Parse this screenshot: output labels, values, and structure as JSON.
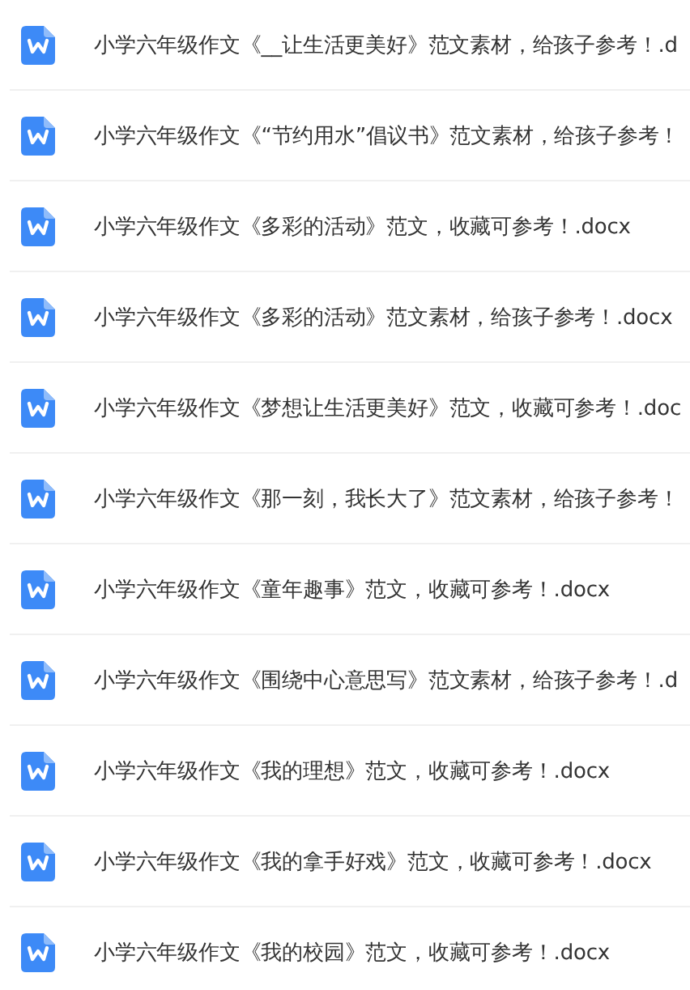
{
  "files": [
    {
      "title": "小学六年级作文《__让生活更美好》范文素材，给孩子参考！.d"
    },
    {
      "title": "小学六年级作文《“节约用水”倡议书》范文素材，给孩子参考！"
    },
    {
      "title": "小学六年级作文《多彩的活动》范文，收藏可参考！.docx"
    },
    {
      "title": "小学六年级作文《多彩的活动》范文素材，给孩子参考！.docx"
    },
    {
      "title": "小学六年级作文《梦想让生活更美好》范文，收藏可参考！.doc"
    },
    {
      "title": "小学六年级作文《那一刻，我长大了》范文素材，给孩子参考！"
    },
    {
      "title": "小学六年级作文《童年趣事》范文，收藏可参考！.docx"
    },
    {
      "title": "小学六年级作文《围绕中心意思写》范文素材，给孩子参考！.d"
    },
    {
      "title": "小学六年级作文《我的理想》范文，收藏可参考！.docx"
    },
    {
      "title": "小学六年级作文《我的拿手好戏》范文，收藏可参考！.docx"
    },
    {
      "title": "小学六年级作文《我的校园》范文，收藏可参考！.docx"
    }
  ]
}
